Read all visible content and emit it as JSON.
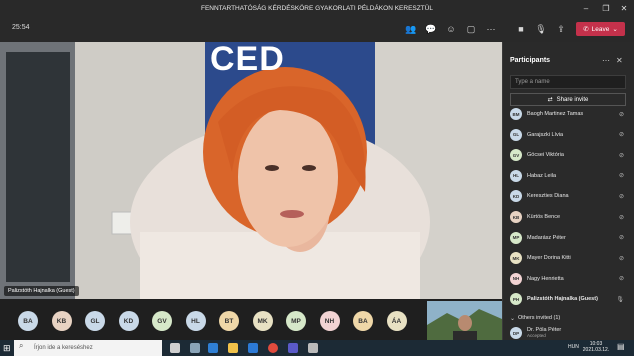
{
  "window": {
    "title": "FENNTARTHATÓSÁG KÉRDÉSKÖRE GYAKORLATI PÉLDÁKON KERESZTÜL"
  },
  "meeting": {
    "elapsed": "25:54",
    "leave_label": "Leave"
  },
  "video": {
    "brand_text": "CED",
    "speaker_name": "Palizstóth Hajnalka (Guest)"
  },
  "gallery": {
    "avatars": [
      {
        "initials": "BA",
        "color": "#c9d9e8"
      },
      {
        "initials": "KB",
        "color": "#e8d3c3"
      },
      {
        "initials": "GL",
        "color": "#c9d9e8"
      },
      {
        "initials": "KD",
        "color": "#c9d9e8"
      },
      {
        "initials": "GV",
        "color": "#d6e8c9"
      },
      {
        "initials": "HL",
        "color": "#c9d9e8"
      },
      {
        "initials": "BT",
        "color": "#efd7a8"
      },
      {
        "initials": "MK",
        "color": "#e8e1c3"
      },
      {
        "initials": "MP",
        "color": "#d6e8c9"
      },
      {
        "initials": "NH",
        "color": "#f2d3d3"
      },
      {
        "initials": "BA",
        "color": "#efd7a8"
      },
      {
        "initials": "ÁA",
        "color": "#e8e1c3"
      }
    ]
  },
  "participants_panel": {
    "title": "Participants",
    "search_placeholder": "Type a name",
    "share_label": "Share invite",
    "items": [
      {
        "initials": "BM",
        "name": "Baogh Martinez Tamas",
        "color": "#c9d9e8"
      },
      {
        "initials": "GL",
        "name": "Garajszki Lívia",
        "color": "#c9d9e8"
      },
      {
        "initials": "GV",
        "name": "Göcsei Viktória",
        "color": "#d6e8c9"
      },
      {
        "initials": "HL",
        "name": "Habaz Leila",
        "color": "#c9d9e8"
      },
      {
        "initials": "KD",
        "name": "Kereszties Diana",
        "color": "#c9d9e8"
      },
      {
        "initials": "KB",
        "name": "Kürtös Bence",
        "color": "#e8d3c3"
      },
      {
        "initials": "MP",
        "name": "Madarász Péter",
        "color": "#d6e8c9"
      },
      {
        "initials": "MK",
        "name": "Mayer Dorina Kitti",
        "color": "#e8e1c3"
      },
      {
        "initials": "NH",
        "name": "Nagy Henrietta",
        "color": "#f2d3d3"
      },
      {
        "initials": "PH",
        "name": "Palizstóth Hajnalka (Guest)",
        "color": "#d6e8c9"
      }
    ],
    "others_label": "Others invited (1)",
    "other": {
      "initials": "DP",
      "name": "Dr. Póla Péter",
      "status": "Accepted",
      "color": "#c9d9e8"
    }
  },
  "taskbar": {
    "search_placeholder": "Írjon ide a kereséshez",
    "lang": "HUN",
    "time": "10:03",
    "date": "2021.03.12."
  }
}
